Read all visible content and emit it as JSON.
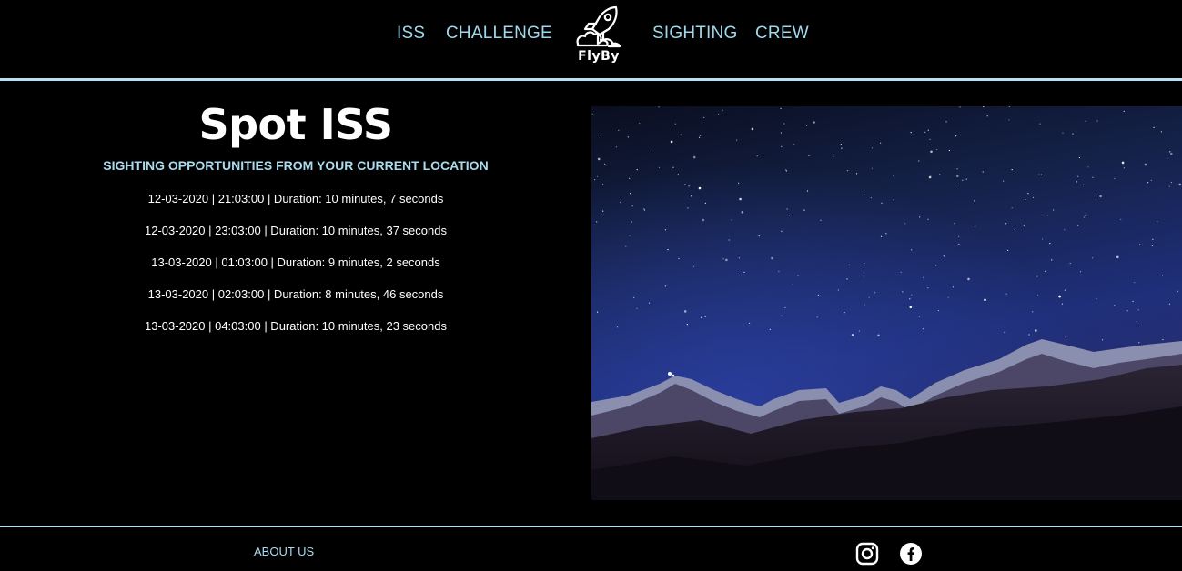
{
  "nav": {
    "items": [
      {
        "label": "ISS"
      },
      {
        "label": "CHALLENGE"
      },
      {
        "label": "SIGHTING"
      },
      {
        "label": "CREW"
      }
    ],
    "logo_text": "FlyBy"
  },
  "main": {
    "title": "Spot ISS",
    "subtitle": "SIGHTING OPPORTUNITIES FROM YOUR CURRENT LOCATION",
    "sightings": [
      "12-03-2020 | 21:03:00 | Duration: 10 minutes, 7 seconds",
      "12-03-2020 | 23:03:00 | Duration: 10 minutes, 37 seconds",
      "13-03-2020 | 01:03:00 | Duration: 9 minutes, 2 seconds",
      "13-03-2020 | 02:03:00 | Duration: 8 minutes, 46 seconds",
      "13-03-2020 | 04:03:00 | Duration: 10 minutes, 23 seconds"
    ]
  },
  "footer": {
    "about_label": "ABOUT US",
    "social": [
      {
        "icon": "instagram-icon"
      },
      {
        "icon": "facebook-icon"
      }
    ]
  },
  "colors": {
    "background": "#000000",
    "accent": "#9fd8ec",
    "divider": "#b8e0f0",
    "text": "#ffffff"
  }
}
